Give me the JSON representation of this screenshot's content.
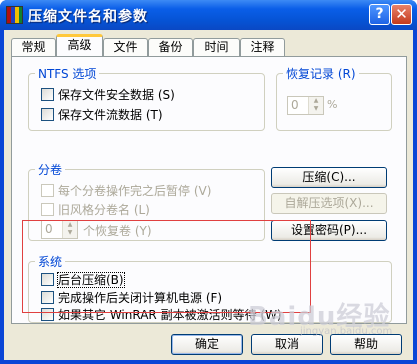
{
  "window": {
    "title": "压缩文件名和参数"
  },
  "tabs": [
    {
      "label": "常规",
      "active": false
    },
    {
      "label": "高级",
      "active": true
    },
    {
      "label": "文件",
      "active": false
    },
    {
      "label": "备份",
      "active": false
    },
    {
      "label": "时间",
      "active": false
    },
    {
      "label": "注释",
      "active": false
    }
  ],
  "ntfs": {
    "legend": "NTFS 选项",
    "options": [
      "保存文件安全数据 (S)",
      "保存文件流数据 (T)"
    ]
  },
  "recovery": {
    "legend": "恢复记录 (R)",
    "value": "0",
    "unit": "%"
  },
  "volumes": {
    "legend": "分卷",
    "options": [
      "每个分卷操作完之后暂停 (V)",
      "旧风格分卷名 (L)"
    ],
    "recovery_value": "0",
    "recovery_label": "个恢复卷 (Y)"
  },
  "side_buttons": {
    "compress": "压缩(C)...",
    "sfx": "自解压选项(X)...",
    "password": "设置密码(P)..."
  },
  "system": {
    "legend": "系统",
    "options": [
      "后台压缩(B)",
      "完成操作后关闭计算机电源 (F)",
      "如果其它 WinRAR 副本被激活则等待 (W)"
    ]
  },
  "footer": {
    "ok": "确定",
    "cancel": "取消",
    "help": "帮助"
  },
  "watermark": {
    "brand": "Baidu经验",
    "url": "jingyan.baidu.com"
  }
}
